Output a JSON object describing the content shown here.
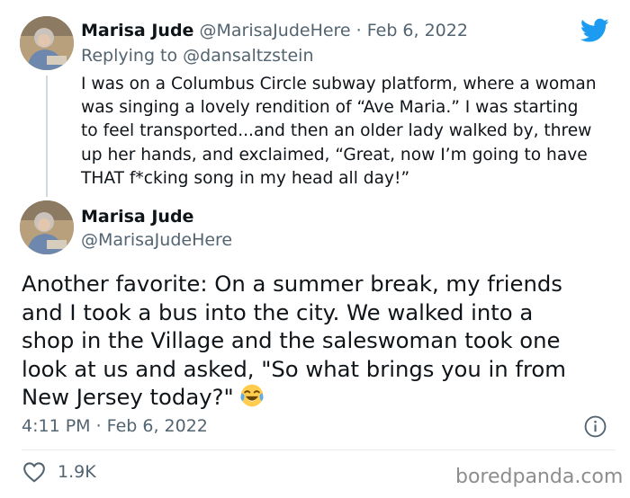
{
  "reply_tweet": {
    "name": "Marisa Jude",
    "handle_date": "@MarisaJudeHere · Feb 6, 2022",
    "replying_to": "Replying to @dansaltzstein",
    "lines": [
      "I was on a Columbus Circle subway platform, where a woman",
      "was singing a lovely rendition of “Ave Maria.” I was starting",
      "to feel transported...and then an older lady walked by, threw",
      "up her hands, and exclaimed, “Great, now I’m going to have",
      "THAT f*cking song in my head all day!”"
    ]
  },
  "main_tweet": {
    "name": "Marisa Jude",
    "handle": "@MarisaJudeHere",
    "lines": [
      "Another favorite: On a summer break, my friends",
      "and I took a bus into the city. We walked into a",
      "shop in the Village and the saleswoman took one",
      "look at us and asked, \"So what brings you in from",
      "New Jersey today?\""
    ],
    "emoji": "face-with-tears-of-joy",
    "timestamp": "4:11 PM · Feb 6, 2022",
    "likes": "1.9K"
  },
  "watermark": "boredpanda.com",
  "colors": {
    "twitter_blue": "#1d9bf0",
    "muted_text": "#536471",
    "thread_line": "#cfd9de"
  },
  "icons": {
    "brand": "twitter-bird-icon",
    "info": "info-icon",
    "like": "heart-icon"
  }
}
